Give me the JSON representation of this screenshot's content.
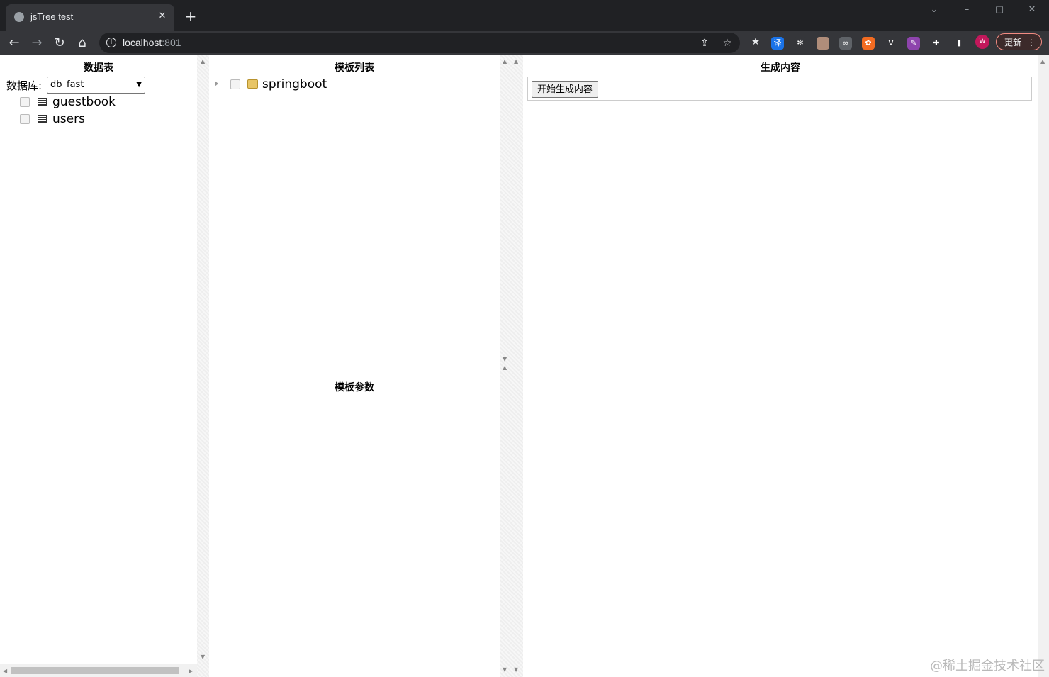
{
  "browser": {
    "tab_title": "jsTree test",
    "tab_close_glyph": "✕",
    "new_tab_glyph": "+",
    "url_host": "localhost",
    "url_port": ":801",
    "update_label": "更新",
    "avatar_letter": "W",
    "window_controls": {
      "chevron": "⌄",
      "minimize": "–",
      "restore": "▢",
      "close": "✕"
    },
    "nav": {
      "back": "←",
      "forward": "→",
      "reload": "↻",
      "home": "⌂"
    },
    "extensions": [
      {
        "name": "translate-extension-icon",
        "label": "译",
        "color": "#1a73e8"
      },
      {
        "name": "colorful-extension-icon",
        "label": "✻",
        "color": "#35363a"
      },
      {
        "name": "circle-extension-icon",
        "label": "",
        "color": "#b08d7a"
      },
      {
        "name": "owl-extension-icon",
        "label": "∞",
        "color": "#5f6368"
      },
      {
        "name": "orange-extension-icon",
        "label": "✿",
        "color": "#f26b21"
      },
      {
        "name": "vue-extension-icon",
        "label": "V",
        "color": "#35363a"
      },
      {
        "name": "purple-extension-icon",
        "label": "✎",
        "color": "#8e44ad"
      },
      {
        "name": "puzzle-extension-icon",
        "label": "✚",
        "color": "#35363a"
      },
      {
        "name": "sidepanel-extension-icon",
        "label": "▮",
        "color": "#35363a"
      }
    ]
  },
  "left_panel": {
    "title": "数据表",
    "db_label": "数据库:",
    "db_selected": "db_fast",
    "tables": [
      "guestbook",
      "users"
    ]
  },
  "middle_panel": {
    "top_title": "模板列表",
    "templates": [
      "springboot"
    ],
    "bottom_title": "模板参数"
  },
  "right_panel": {
    "title": "生成内容",
    "generate_button": "开始生成内容"
  },
  "watermark": "@稀土掘金技术社区"
}
